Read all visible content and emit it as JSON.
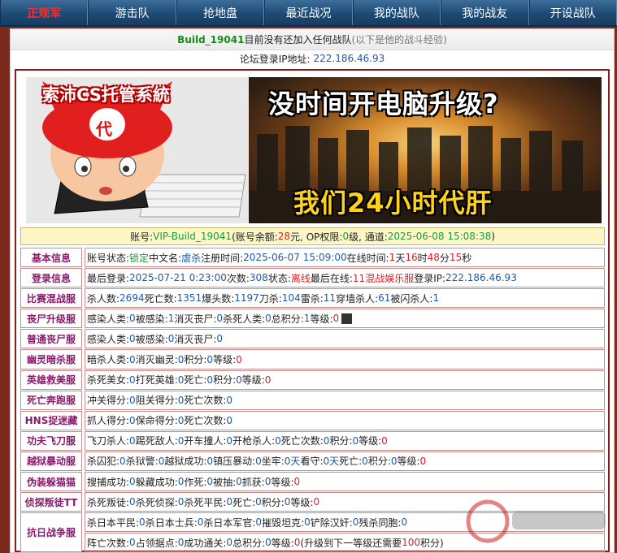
{
  "nav": {
    "items": [
      "正规军",
      "游击队",
      "抢地盘",
      "最近战况",
      "我的战队",
      "我的战友",
      "开设战队"
    ]
  },
  "notice": {
    "username": "Build_19041",
    "text": "目前没有还加入任何战队",
    "hint": "(以下是他的战斗经验)"
  },
  "ip": {
    "label": "论坛登录IP地址:",
    "value": "222.186.46.93"
  },
  "banner": {
    "logo": "索沛CS托管系統",
    "badge": "代",
    "slogan_top": "没时间开电脑升级?",
    "slogan_bottom": "我们24小时代肝"
  },
  "account": {
    "label": "账号: ",
    "id": "VIP-Build_19041",
    "balance_label": "(账号余额: ",
    "balance": "28",
    "balance_unit": "元, OP权限: ",
    "op": "0",
    "op_unit": "级, 通道: ",
    "channel_time": "2025-06-08 15:08:38",
    "close": ")"
  },
  "rows": {
    "basic": {
      "label": "基本信息",
      "s1": "账号状态: ",
      "status": "锁定",
      "s2": " 中文名: ",
      "cn_name": "虐杀",
      "s3": " 注册时间: ",
      "reg_time": "2025-06-07 15:09:00",
      "s4": " 在线时间: ",
      "d": "1",
      "s5": "天",
      "h": "16",
      "s6": "时",
      "m": "48",
      "s7": "分",
      "sec": "15",
      "s8": "秒"
    },
    "login": {
      "label": "登录信息",
      "s1": "最后登录: ",
      "last_login": "2025-07-21 0:23:00",
      "s2": " 次数: ",
      "count": "308",
      "s3": " 状态: ",
      "state": "离线",
      "s4": " 最后在线: ",
      "last_server": "11混战娱乐服",
      "s5": " 登录IP: ",
      "ip": "222.186.46.93"
    },
    "match": {
      "label": "比赛混战服",
      "s1": "杀人数: ",
      "kills": "2694",
      "s2": " 死亡数: ",
      "deaths": "1351",
      "s3": " 爆头数: ",
      "hs": "1197",
      "s4": " 刀杀: ",
      "knife": "104",
      "s5": " 雷杀: ",
      "nade": "11",
      "s6": " 穿墙杀人: ",
      "wall": "61",
      "s7": " 被闪杀人: ",
      "flash": "1"
    },
    "zombie_up": {
      "label": "丧尸升级服",
      "s1": "感染人类: ",
      "a": "0",
      "s2": " 被感染: ",
      "b": "1",
      "s3": " 消灭丧尸: ",
      "c": "0",
      "s4": " 杀死人类: ",
      "d": "0",
      "s5": " 总积分: ",
      "e": "1",
      "s6": " 等级: ",
      "f": "0"
    },
    "zombie": {
      "label": "普通丧尸服",
      "s1": "感染人类: ",
      "a": "0",
      "s2": " 被感染: ",
      "b": "0",
      "s3": " 消灭丧尸: ",
      "c": "0"
    },
    "ghost": {
      "label": "幽灵暗杀服",
      "s1": "暗杀人类: ",
      "a": "0",
      "s2": " 消灭幽灵: ",
      "b": "0",
      "s3": " 积分: ",
      "c": "0",
      "s4": " 等级: ",
      "d": "0"
    },
    "hero": {
      "label": "英雄救美服",
      "s1": "杀死美女: ",
      "a": "0",
      "s2": " 打死英雄: ",
      "b": "0",
      "s3": " 死亡: ",
      "c": "0",
      "s4": " 积分: ",
      "d": "0",
      "s5": " 等级: ",
      "e": "0"
    },
    "run": {
      "label": "死亡奔跑服",
      "s1": "冲关得分: ",
      "a": "0",
      "s2": " 阻关得分: ",
      "b": "0",
      "s3": " 死亡次数: ",
      "c": "0"
    },
    "hns": {
      "label": "HNS捉迷藏",
      "s1": "抓人得分: ",
      "a": "0",
      "s2": " 保命得分: ",
      "b": "0",
      "s3": " 死亡次数: ",
      "c": "0"
    },
    "kungfu": {
      "label": "功夫飞刀服",
      "s1": "飞刀杀人: ",
      "a": "0",
      "s2": " 踢死敌人: ",
      "b": "0",
      "s3": " 开车撞人: ",
      "c": "0",
      "s4": " 开枪杀人: ",
      "d": "0",
      "s5": " 死亡次数: ",
      "e": "0",
      "s6": " 积分: ",
      "f": "0",
      "s7": " 等级: ",
      "g": "0"
    },
    "jail": {
      "label": "越狱暴动服",
      "s1": "杀囚犯: ",
      "a": "0",
      "s2": " 杀狱警: ",
      "b": "0",
      "s3": " 越狱成功: ",
      "c": "0",
      "s4": " 镇压暴动: ",
      "d": "0",
      "s5": " 坐牢: ",
      "e": "0天",
      "s6": " 看守: ",
      "f": "0天",
      "s7": " 死亡: ",
      "g": "0",
      "s8": " 积分: ",
      "h": "0",
      "s9": " 等级: ",
      "i": "0"
    },
    "prop": {
      "label": "伪装躲猫猫",
      "s1": "搜捕成功: ",
      "a": "0",
      "s2": " 躲藏成功: ",
      "b": "0",
      "s3": " 作死: ",
      "c": "0",
      "s4": " 被抽: ",
      "d": "0",
      "s5": " 抓获: ",
      "e": "0",
      "s6": " 等级: ",
      "f": "0"
    },
    "zp": {
      "label": "侦探叛徒TT",
      "s1": "杀死叛徒: ",
      "a": "0",
      "s2": " 杀死侦探: ",
      "b": "0",
      "s3": " 杀死平民: ",
      "c": "0",
      "s4": " 死亡: ",
      "d": "0",
      "s5": " 积分: ",
      "e": "0",
      "s6": " 等级: ",
      "f": "0"
    },
    "war": {
      "label": "抗日战争服",
      "l1": {
        "s1": "杀日本平民: ",
        "a": "0",
        "s2": " 杀日本士兵: ",
        "b": "0",
        "s3": " 杀日本军官: ",
        "c": "0",
        "s4": " 摧毁坦克: ",
        "d": "0",
        "s5": " 铲除汉奸: ",
        "e": "0",
        "s6": " 残杀同胞: ",
        "f": "0"
      },
      "l2": {
        "s1": "阵亡次数: ",
        "a": "0",
        "s2": " 占领据点: ",
        "b": "0",
        "s3": " 成功通关: ",
        "c": "0",
        "s4": " 总积分: ",
        "d": "0",
        "s5": " 等级: ",
        "e": "0",
        "s6": " (升级到下一等级还需要",
        "f": "100",
        "s7": "积分)"
      }
    }
  }
}
